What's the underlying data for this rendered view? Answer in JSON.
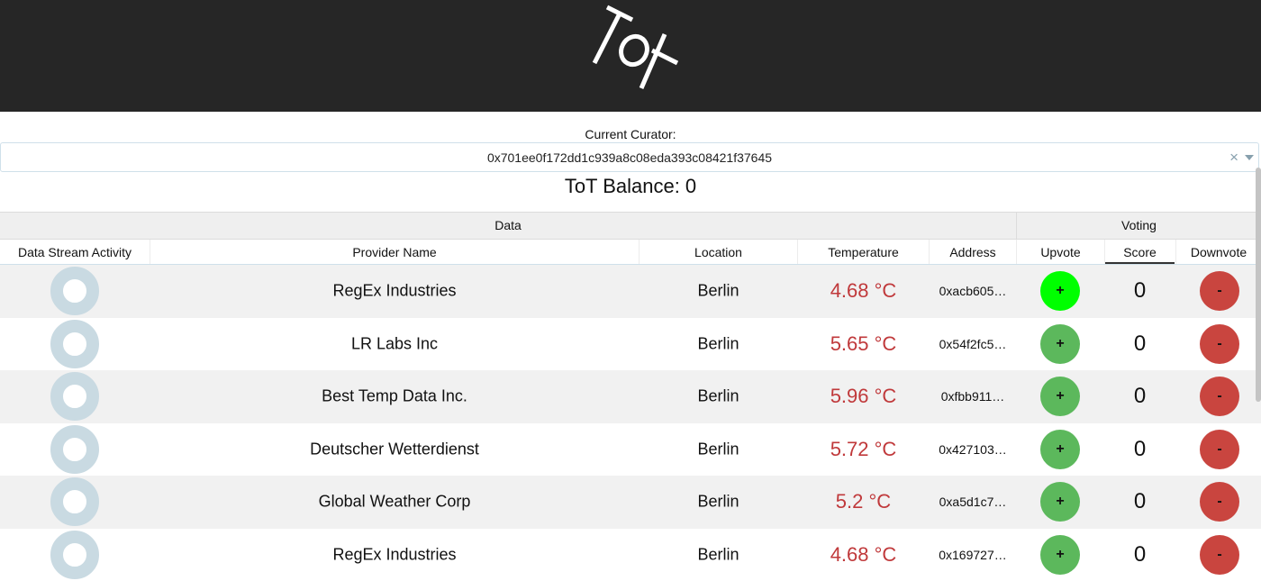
{
  "header": {
    "logo_icon": "tot-logo"
  },
  "curator": {
    "label": "Current Curator:",
    "value": "0x701ee0f172dd1c939a8c08eda393c08421f37645",
    "clear_glyph": "×"
  },
  "balance": "ToT Balance: 0",
  "table": {
    "groups": {
      "data": "Data",
      "voting": "Voting"
    },
    "columns": {
      "activity": "Data Stream Activity",
      "provider": "Provider Name",
      "location": "Location",
      "temperature": "Temperature",
      "address": "Address",
      "upvote": "Upvote",
      "score": "Score",
      "downvote": "Downvote"
    },
    "upvote_label": "+",
    "downvote_label": "-",
    "rows": [
      {
        "provider": "RegEx Industries",
        "location": "Berlin",
        "temperature": "4.68 °C",
        "address": "0xacb605…",
        "score": "0"
      },
      {
        "provider": "LR Labs Inc",
        "location": "Berlin",
        "temperature": "5.65 °C",
        "address": "0x54f2fc5…",
        "score": "0"
      },
      {
        "provider": "Best Temp Data Inc.",
        "location": "Berlin",
        "temperature": "5.96 °C",
        "address": "0xfbb911…",
        "score": "0"
      },
      {
        "provider": "Deutscher Wetterdienst",
        "location": "Berlin",
        "temperature": "5.72 °C",
        "address": "0x427103…",
        "score": "0"
      },
      {
        "provider": "Global Weather Corp",
        "location": "Berlin",
        "temperature": "5.2 °C",
        "address": "0xa5d1c7…",
        "score": "0"
      },
      {
        "provider": "RegEx Industries",
        "location": "Berlin",
        "temperature": "4.68 °C",
        "address": "0x169727…",
        "score": "0"
      }
    ]
  },
  "colors": {
    "header_bg": "#262626",
    "upvote_active": "#00ff00",
    "upvote": "#5cb85c",
    "downvote": "#c9453f",
    "temperature": "#c0393b",
    "activity_ring": "#c9dae2"
  }
}
